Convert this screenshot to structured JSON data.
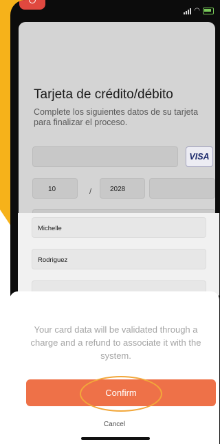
{
  "status_bar": {
    "signal_icon": "signal-icon",
    "wifi_icon": "wifi-icon",
    "battery_icon": "battery-charging-icon"
  },
  "card_form": {
    "title": "Tarjeta de crédito/débito",
    "description": "Complete los siguientes datos de su tarjeta para finalizar el proceso.",
    "card_number": "",
    "card_brand": "VISA",
    "expiry_month": "10",
    "date_separator": "/",
    "expiry_year": "2028",
    "cvv": "",
    "first_name": "Michelle",
    "last_name": "Rodriguez",
    "extra_field": ""
  },
  "sheet": {
    "message": "Your card data will be validated through a charge and a refund to associate it with the system.",
    "confirm_label": "Confirm",
    "cancel_label": "Cancel"
  },
  "colors": {
    "accent": "#ee7148",
    "highlight": "#f2a73a",
    "background_shape": "#f6b21a"
  }
}
